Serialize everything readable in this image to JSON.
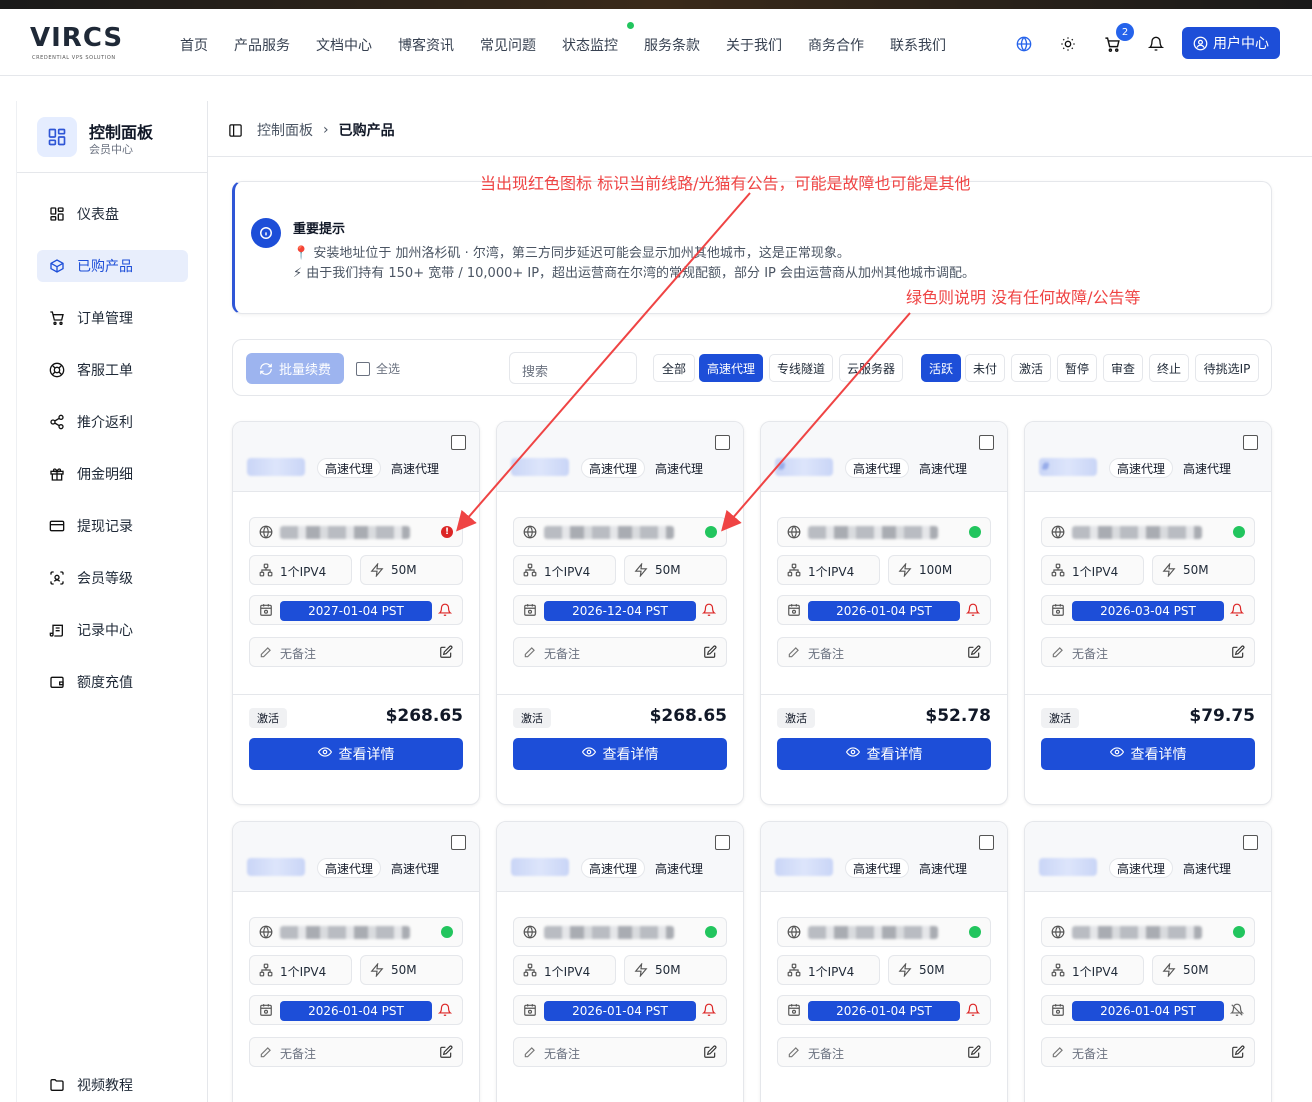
{
  "header": {
    "logo": "VIRCS",
    "logo_sub": "CREDENTIAL VPS SOLUTION",
    "nav": [
      "首页",
      "产品服务",
      "文档中心",
      "博客资讯",
      "常见问题",
      "状态监控",
      "服务条款",
      "关于我们",
      "商务合作",
      "联系我们"
    ],
    "cart_count": "2",
    "user_center": "用户中心"
  },
  "sidebar": {
    "title": "控制面板",
    "subtitle": "会员中心",
    "items": [
      {
        "label": "仪表盘",
        "icon": "grid-icon"
      },
      {
        "label": "已购产品",
        "icon": "box-icon",
        "active": true
      },
      {
        "label": "订单管理",
        "icon": "cart-icon"
      },
      {
        "label": "客服工单",
        "icon": "lifebuoy-icon"
      },
      {
        "label": "推介返利",
        "icon": "share-icon"
      },
      {
        "label": "佣金明细",
        "icon": "gift-icon"
      },
      {
        "label": "提现记录",
        "icon": "credit-card-icon"
      },
      {
        "label": "会员等级",
        "icon": "scan-face-icon"
      },
      {
        "label": "记录中心",
        "icon": "scroll-icon"
      },
      {
        "label": "额度充值",
        "icon": "wallet-icon"
      }
    ],
    "bottom_item": {
      "label": "视频教程",
      "icon": "folder-icon"
    }
  },
  "breadcrumb": {
    "parent": "控制面板",
    "current": "已购产品"
  },
  "notice": {
    "title": "重要提示",
    "line1": "📍 安装地址位于 加州洛杉矶 · 尔湾，第三方同步延迟可能会显示加州其他城市，这是正常现象。",
    "line2": "⚡ 由于我们持有 150+ 宽带 / 10,000+ IP，超出运营商在尔湾的常规配额，部分 IP 会由运营商从加州其他城市调配。"
  },
  "annotations": {
    "red": "当出现红色图标 标识当前线路/光猫有公告，可能是故障也可能是其他",
    "green": "绿色则说明 没有任何故障/公告等"
  },
  "filters": {
    "renew": "批量续费",
    "select_all": "全选",
    "search_placeholder": "搜索",
    "types": [
      "全部",
      "高速代理",
      "专线隧道",
      "云服务器"
    ],
    "active_type": "高速代理",
    "states": [
      "活跃",
      "未付",
      "激活",
      "暂停",
      "审查",
      "终止",
      "待挑选IP"
    ],
    "active_state": "活跃"
  },
  "colors": {
    "primary": "#1d4ed8",
    "status_ok": "#22c55e",
    "status_alert": "#dc2626",
    "annotation": "#ef4444"
  },
  "cards": [
    {
      "name": "",
      "tag1": "高速代理",
      "tag2": "高速代理",
      "status": "alert",
      "ipv4": "1个IPV4",
      "bandwidth": "50M",
      "date": "2027-01-04 PST",
      "bell": "on",
      "note": "无备注",
      "state": "激活",
      "price": "$268.65",
      "detail": "查看详情"
    },
    {
      "name": "",
      "tag1": "高速代理",
      "tag2": "高速代理",
      "status": "ok",
      "ipv4": "1个IPV4",
      "bandwidth": "50M",
      "date": "2026-12-04 PST",
      "bell": "on",
      "note": "无备注",
      "state": "激活",
      "price": "$268.65",
      "detail": "查看详情"
    },
    {
      "name": "#",
      "tag1": "高速代理",
      "tag2": "高速代理",
      "status": "ok",
      "ipv4": "1个IPV4",
      "bandwidth": "100M",
      "date": "2026-01-04 PST",
      "bell": "on",
      "note": "无备注",
      "state": "激活",
      "price": "$52.78",
      "detail": "查看详情"
    },
    {
      "name": "#",
      "tag1": "高速代理",
      "tag2": "高速代理",
      "status": "ok",
      "ipv4": "1个IPV4",
      "bandwidth": "50M",
      "date": "2026-03-04 PST",
      "bell": "on",
      "note": "无备注",
      "state": "激活",
      "price": "$79.75",
      "detail": "查看详情"
    },
    {
      "name": "",
      "tag1": "高速代理",
      "tag2": "高速代理",
      "status": "ok",
      "ipv4": "1个IPV4",
      "bandwidth": "50M",
      "date": "2026-01-04 PST",
      "bell": "on",
      "note": "无备注"
    },
    {
      "name": "",
      "tag1": "高速代理",
      "tag2": "高速代理",
      "status": "ok",
      "ipv4": "1个IPV4",
      "bandwidth": "50M",
      "date": "2026-01-04 PST",
      "bell": "on",
      "note": "无备注"
    },
    {
      "name": "",
      "tag1": "高速代理",
      "tag2": "高速代理",
      "status": "ok",
      "ipv4": "1个IPV4",
      "bandwidth": "50M",
      "date": "2026-01-04 PST",
      "bell": "on",
      "note": "无备注"
    },
    {
      "name": "",
      "tag1": "高速代理",
      "tag2": "高速代理",
      "status": "ok",
      "ipv4": "1个IPV4",
      "bandwidth": "50M",
      "date": "2026-01-04 PST",
      "bell": "off",
      "note": "无备注"
    }
  ]
}
